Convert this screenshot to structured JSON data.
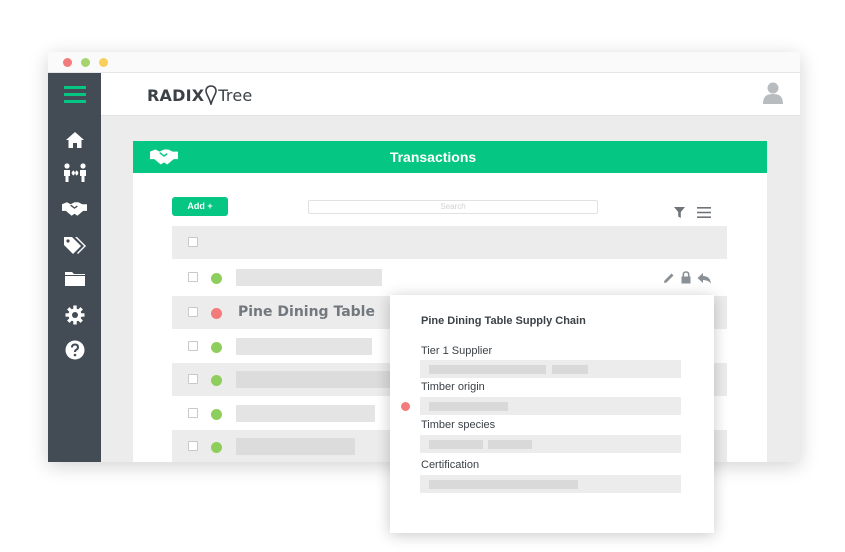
{
  "app": {
    "logo_left": "RADIX",
    "logo_right": "Tree",
    "brand_color": "#05c683"
  },
  "sidebar": {
    "items": [
      {
        "icon": "menu-icon"
      },
      {
        "icon": "home-icon"
      },
      {
        "icon": "people-exchange-icon"
      },
      {
        "icon": "handshake-icon"
      },
      {
        "icon": "tags-icon"
      },
      {
        "icon": "folder-icon"
      },
      {
        "icon": "gear-icon"
      },
      {
        "icon": "help-icon"
      }
    ]
  },
  "panel": {
    "title": "Transactions",
    "add_label": "Add +",
    "search_placeholder": "Search"
  },
  "table": {
    "rows": [
      {
        "status": "ok",
        "name": ""
      },
      {
        "status": "bad",
        "name": "Pine Dining Table"
      },
      {
        "status": "ok",
        "name": ""
      },
      {
        "status": "ok",
        "name": ""
      },
      {
        "status": "ok",
        "name": ""
      },
      {
        "status": "ok",
        "name": ""
      }
    ]
  },
  "popup": {
    "title": "Pine Dining Table Supply Chain",
    "fields": [
      {
        "label": "Tier 1 Supplier"
      },
      {
        "label": "Timber origin"
      },
      {
        "label": "Timber species"
      },
      {
        "label": "Certification"
      }
    ]
  }
}
